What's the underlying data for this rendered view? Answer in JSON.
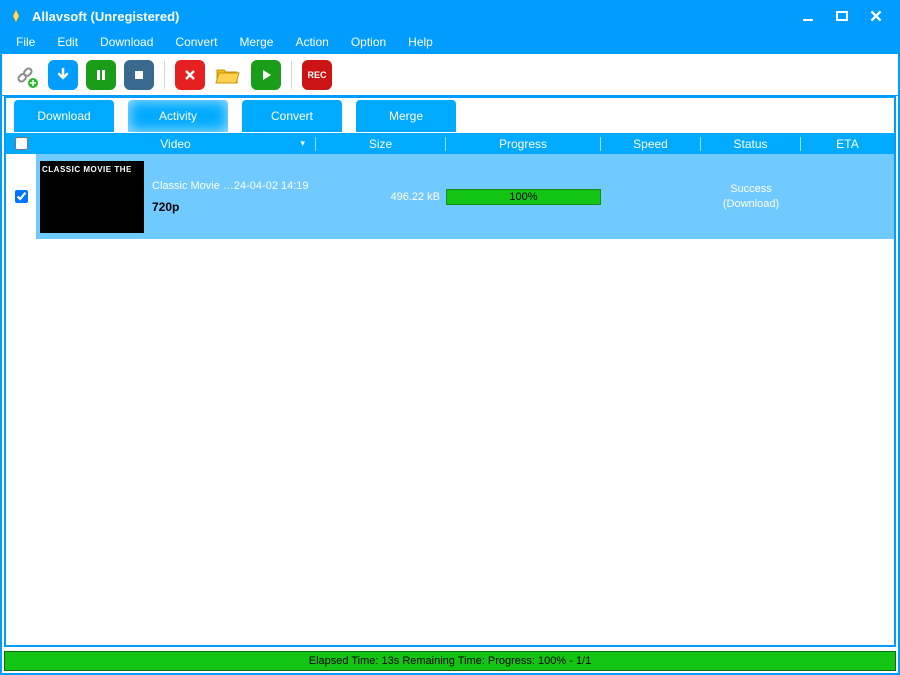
{
  "window": {
    "title": "Allavsoft (Unregistered)"
  },
  "menu": {
    "items": [
      "File",
      "Edit",
      "Download",
      "Convert",
      "Merge",
      "Action",
      "Option",
      "Help"
    ]
  },
  "toolbar": {
    "rec_label": "REC"
  },
  "tabs": {
    "items": [
      "Download",
      "Activity",
      "Convert",
      "Merge"
    ],
    "active_index": 1
  },
  "columns": {
    "video": "Video",
    "size": "Size",
    "progress": "Progress",
    "speed": "Speed",
    "status": "Status",
    "eta": "ETA"
  },
  "rows": [
    {
      "checked": true,
      "thumb_text": "CLASSIC MOVIE THE",
      "name": "Classic Movie …24-04-02 14:19",
      "quality": "720p",
      "size": "496.22 kB",
      "progress_pct": "100%",
      "speed": "",
      "status_line1": "Success",
      "status_line2": "(Download)",
      "eta": ""
    }
  ],
  "statusbar": {
    "text": "Elapsed Time: 13s Remaining Time:  Progress: 100%  -  1/1"
  }
}
